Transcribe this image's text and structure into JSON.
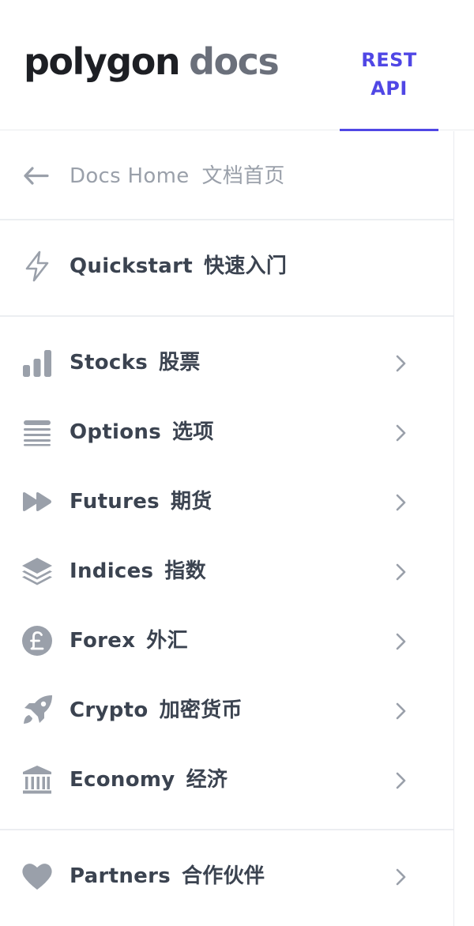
{
  "header": {
    "logo_brand": "polygon",
    "logo_sub": "docs",
    "active_tab": "REST API"
  },
  "sidebar": {
    "home": {
      "label": "Docs Home",
      "label_zh": "文档首页",
      "icon": "arrow-left-icon"
    },
    "quickstart": {
      "label": "Quickstart",
      "label_zh": "快速入门",
      "icon": "lightning-icon"
    },
    "items": [
      {
        "label": "Stocks",
        "label_zh": "股票",
        "icon": "bar-chart-icon"
      },
      {
        "label": "Options",
        "label_zh": "选项",
        "icon": "stacked-lines-icon"
      },
      {
        "label": "Futures",
        "label_zh": "期货",
        "icon": "fast-forward-icon"
      },
      {
        "label": "Indices",
        "label_zh": "指数",
        "icon": "layers-icon"
      },
      {
        "label": "Forex",
        "label_zh": "外汇",
        "icon": "pound-coin-icon"
      },
      {
        "label": "Crypto",
        "label_zh": "加密货币",
        "icon": "rocket-icon"
      },
      {
        "label": "Economy",
        "label_zh": "经济",
        "icon": "bank-icon"
      }
    ],
    "partners": {
      "label": "Partners",
      "label_zh": "合作伙伴",
      "icon": "heart-icon"
    }
  },
  "colors": {
    "accent": "#5047e5",
    "icon_gray": "#9aa0aa",
    "text_dark": "#3b4350",
    "divider": "#eceef1"
  }
}
